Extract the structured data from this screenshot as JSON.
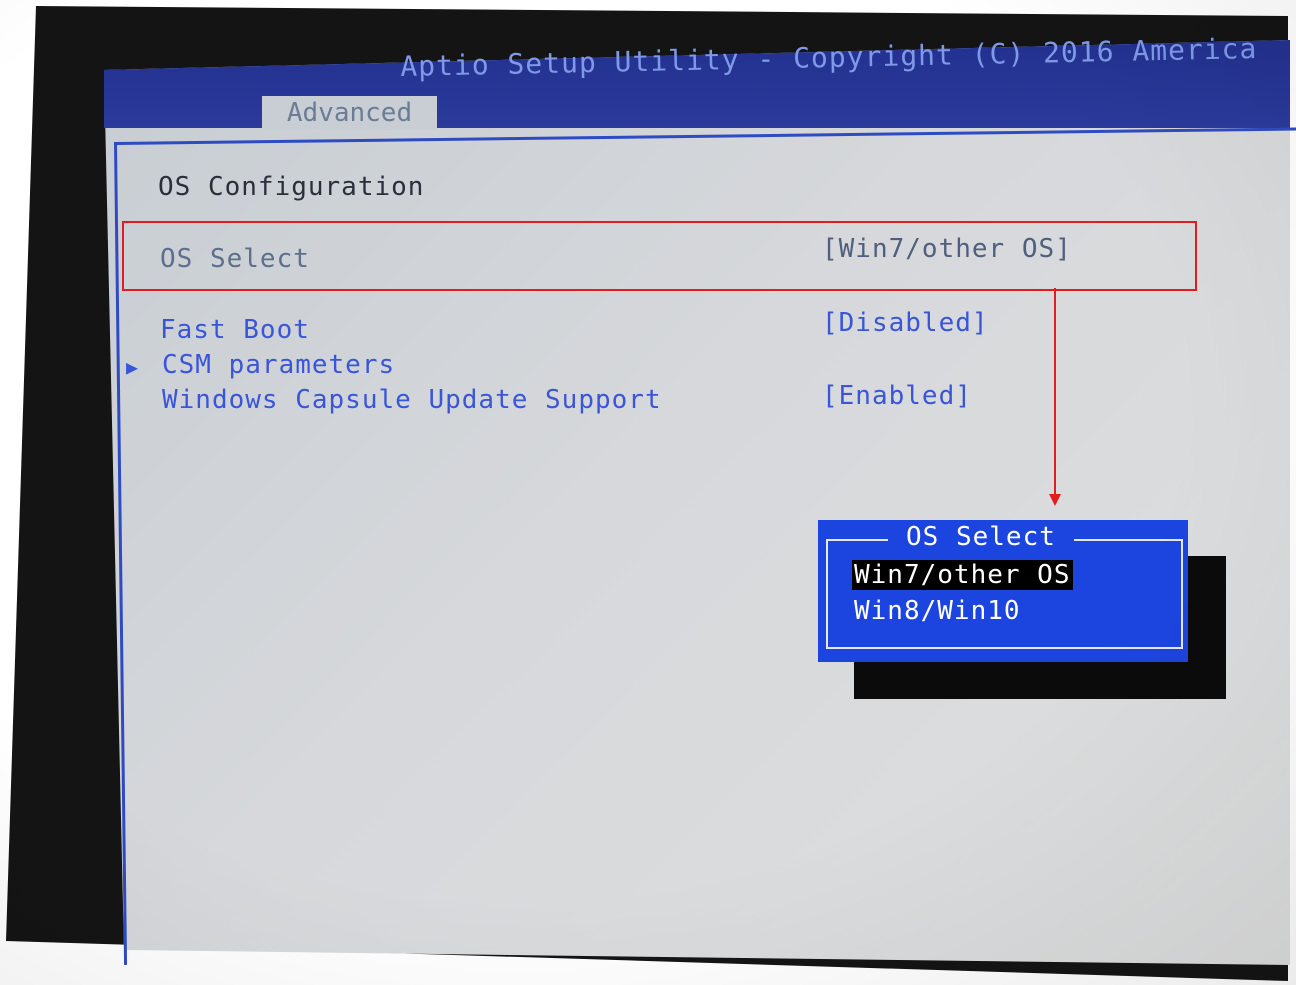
{
  "title_bar": {
    "text": "Aptio Setup Utility - Copyright (C) 2016 America"
  },
  "tabs": [
    {
      "label": "Advanced"
    }
  ],
  "section": {
    "heading": "OS Configuration"
  },
  "settings": [
    {
      "label": "OS Select",
      "value": "[Win7/other OS]"
    },
    {
      "label": "Fast Boot",
      "value": "[Disabled]"
    },
    {
      "label": "CSM parameters",
      "submenu_marker": "▶"
    },
    {
      "label": "Windows Capsule Update Support",
      "value": "[Enabled]"
    }
  ],
  "popup": {
    "title": "OS Select",
    "options": [
      {
        "label": "Win7/other OS",
        "selected": true
      },
      {
        "label": "Win8/Win10",
        "selected": false
      }
    ]
  },
  "colors": {
    "title_bar": "#22318f",
    "popup_bg": "#1c45e0",
    "annotation_red": "#e31d1d",
    "item_blue": "#3a56d8"
  }
}
